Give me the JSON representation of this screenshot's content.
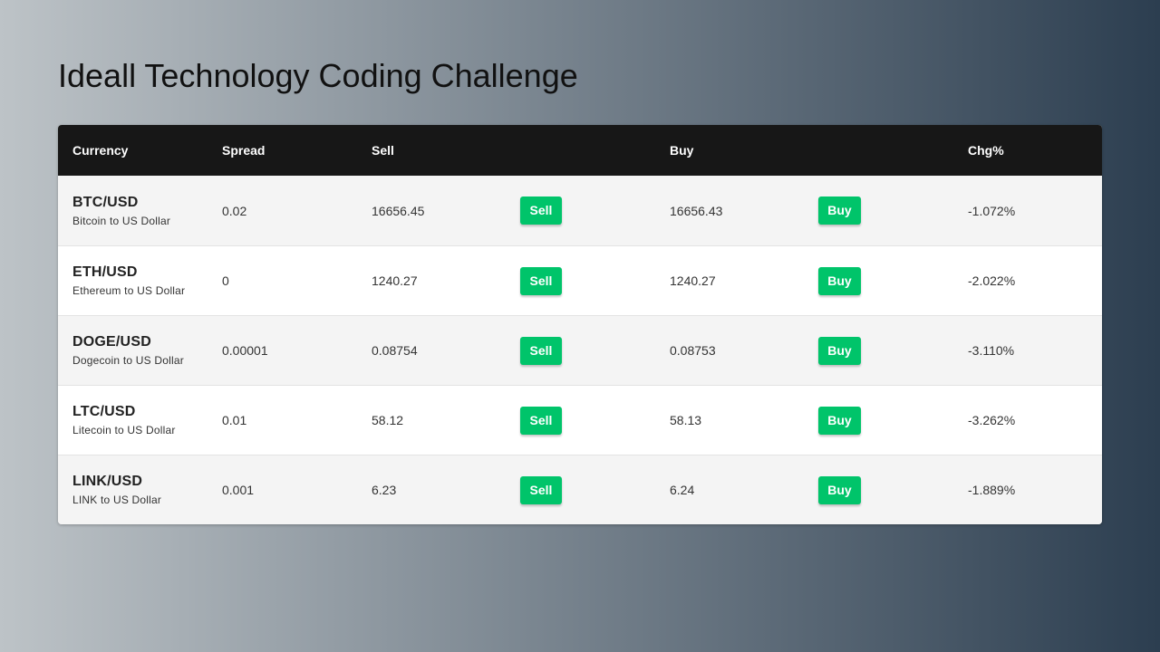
{
  "page": {
    "title": "Ideall Technology Coding Challenge"
  },
  "table": {
    "headers": {
      "currency": "Currency",
      "spread": "Spread",
      "sell": "Sell",
      "buy": "Buy",
      "chg": "Chg%"
    },
    "rows": [
      {
        "pair": "BTC/USD",
        "description": "Bitcoin to US Dollar",
        "spread": "0.02",
        "sell_price": "16656.45",
        "sell_label": "Sell",
        "buy_price": "16656.43",
        "buy_label": "Buy",
        "change": "-1.072%"
      },
      {
        "pair": "ETH/USD",
        "description": "Ethereum to US Dollar",
        "spread": "0",
        "sell_price": "1240.27",
        "sell_label": "Sell",
        "buy_price": "1240.27",
        "buy_label": "Buy",
        "change": "-2.022%"
      },
      {
        "pair": "DOGE/USD",
        "description": "Dogecoin to US Dollar",
        "spread": "0.00001",
        "sell_price": "0.08754",
        "sell_label": "Sell",
        "buy_price": "0.08753",
        "buy_label": "Buy",
        "change": "-3.110%"
      },
      {
        "pair": "LTC/USD",
        "description": "Litecoin to US Dollar",
        "spread": "0.01",
        "sell_price": "58.12",
        "sell_label": "Sell",
        "buy_price": "58.13",
        "buy_label": "Buy",
        "change": "-3.262%"
      },
      {
        "pair": "LINK/USD",
        "description": "LINK to US Dollar",
        "spread": "0.001",
        "sell_price": "6.23",
        "sell_label": "Sell",
        "buy_price": "6.24",
        "buy_label": "Buy",
        "change": "-1.889%"
      }
    ]
  },
  "colors": {
    "header_bg": "#171717",
    "button_green": "#00c46a",
    "row_shade": "#f4f4f4",
    "gradient_start": "#bdc3c7",
    "gradient_end": "#2c3e50"
  }
}
